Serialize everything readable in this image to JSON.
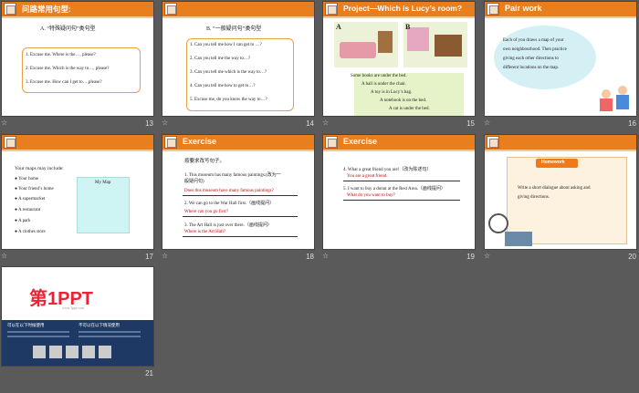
{
  "slides": [
    {
      "number": "13",
      "title": "问路常用句型:",
      "subtitle": "A. “特殊疑问句”类句型",
      "lines": [
        "1. Excuse me. Where is the…, please?",
        "2. Excuse me. Which is the way to…, please?",
        "3. Excuse me. How can I get to…,please?"
      ]
    },
    {
      "number": "14",
      "subtitle": "B. “一般疑问句”类句型",
      "lines": [
        "1. Can you tell me how I can get to …?",
        "2. Can you tell me the way to…?",
        "3. Can you tell me which is the way to…?",
        "4. Can you tell me how to get to…?",
        "5. Excuse me, do you know the way to…?"
      ]
    },
    {
      "number": "15",
      "title": "Project—Which is Lucy’s room?",
      "labels": [
        "A",
        "B"
      ],
      "lines": [
        "Some books are under the bed.",
        "A ball is under the chair.",
        "A toy is in Lucy’s bag.",
        "A notebook is on the bed.",
        "A cat is under the bed."
      ]
    },
    {
      "number": "16",
      "title": "Pair work",
      "cloud": [
        "Each of you draws a map of your",
        "own neighbourhood. Then practice",
        "giving  each other directions to",
        "different locations on the map."
      ]
    },
    {
      "number": "17",
      "intro": "Your maps may include:",
      "map_label": "My Map",
      "items": [
        "Your  home",
        "Your friend’s home",
        "A  supermarket",
        "A restaurant",
        "A park",
        "A clothes store"
      ]
    },
    {
      "number": "18",
      "title": "Exercise",
      "instruction": "按要求改写句子。",
      "q1": [
        "1. This museum has many famous paintings.(改为一",
        "般疑问句)"
      ],
      "a1": "Does this museum have many famous paintings?",
      "q2": "2. We can go to the War Hall first.（画线提问）",
      "a2": "Where can you go first?",
      "q3": "3. The Art Hall is just over there.（画线提问）",
      "a3": "Where is the Art Hall?"
    },
    {
      "number": "19",
      "title": "Exercise",
      "q4": "4. What a great friend you are!（改为陈述句）",
      "a4": "You are a great friend.",
      "q5": "5. I want to buy a donut at the Rest Area.（画线提问）",
      "a5": "What do you want to buy?"
    },
    {
      "number": "20",
      "banner": "Homework",
      "lines": [
        "Write a short dialogue about asking and",
        "giving  directions."
      ]
    },
    {
      "number": "21",
      "logo": "第1PPT",
      "logo_sub": "www.1ppt.com",
      "left_head": "可以在以下时候使用",
      "right_head": "不可以在以下情况使用"
    }
  ],
  "star_glyph": "☆"
}
